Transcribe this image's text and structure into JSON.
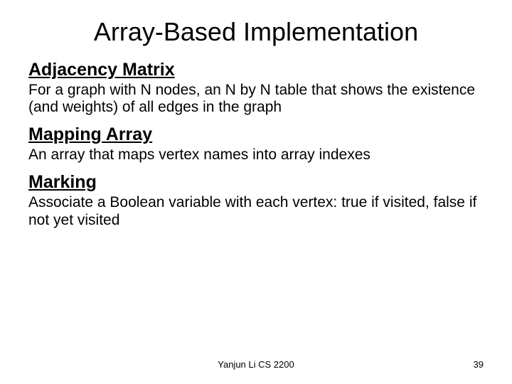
{
  "title": "Array-Based Implementation",
  "sections": [
    {
      "heading": "Adjacency Matrix",
      "body": "For a graph with N nodes, an N by N table that shows the existence (and weights) of all edges in the graph"
    },
    {
      "heading": "Mapping Array",
      "body": "An array that maps vertex names into array indexes"
    },
    {
      "heading": "Marking",
      "body": "Associate a Boolean variable with each vertex: true if visited, false if not yet visited"
    }
  ],
  "footer": {
    "center": "Yanjun Li CS 2200",
    "page": "39"
  }
}
